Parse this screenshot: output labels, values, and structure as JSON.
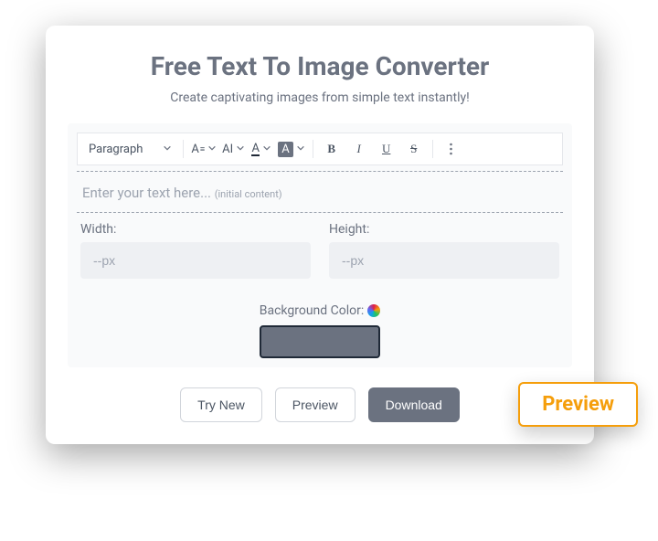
{
  "title": "Free Text To Image Converter",
  "subtitle": "Create captivating images from simple text instantly!",
  "toolbar": {
    "paragraph": "Paragraph",
    "font_size_glyph": "A",
    "case_glyph": "AI",
    "font_color_glyph": "A",
    "highlight_glyph": "A",
    "bold": "B",
    "italic": "I",
    "underline": "U",
    "strike": "S"
  },
  "editor": {
    "placeholder": "Enter your text here...",
    "hint": "(initial content)"
  },
  "width": {
    "label": "Width:",
    "placeholder": "--px"
  },
  "height": {
    "label": "Height:",
    "placeholder": "--px"
  },
  "bg": {
    "label": "Background Color:"
  },
  "buttons": {
    "try_new": "Try New",
    "preview": "Preview",
    "download": "Download"
  },
  "badge": "Preview"
}
